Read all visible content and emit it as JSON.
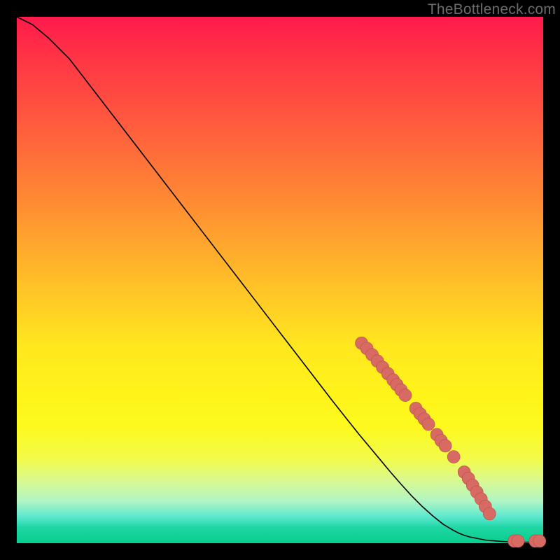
{
  "watermark": "TheBottleneck.com",
  "colors": {
    "frame": "#000000",
    "curve": "#000000",
    "marker_fill": "#d76a63",
    "marker_stroke": "#b94f48"
  },
  "chart_data": {
    "type": "line",
    "title": "",
    "xlabel": "",
    "ylabel": "",
    "xlim": [
      0,
      100
    ],
    "ylim": [
      0,
      100
    ],
    "grid": false,
    "legend": false,
    "series": [
      {
        "name": "bottleneck-curve",
        "x": [
          0,
          3,
          6,
          10,
          15,
          20,
          25,
          30,
          35,
          40,
          45,
          50,
          55,
          60,
          63,
          65,
          67,
          69,
          71,
          73,
          75,
          77,
          79,
          81,
          83,
          84,
          85,
          86,
          87,
          88,
          89,
          90,
          92,
          94,
          95,
          96,
          97,
          98,
          99,
          100
        ],
        "y": [
          100,
          98.5,
          96,
          92,
          85.5,
          79,
          72.5,
          66,
          59.5,
          53,
          46.5,
          40,
          33.5,
          27,
          23.2,
          20.7,
          18.3,
          15.9,
          13.5,
          11.2,
          9,
          7,
          5.2,
          3.6,
          2.4,
          1.9,
          1.5,
          1.2,
          1.0,
          0.8,
          0.6,
          0.5,
          0.35,
          0.25,
          0.22,
          0.2,
          0.2,
          0.2,
          0.2,
          0.2
        ]
      }
    ],
    "markers": [
      {
        "x": 65.5,
        "y": 38,
        "r": 1.2
      },
      {
        "x": 66.5,
        "y": 37,
        "r": 1.2
      },
      {
        "x": 67.5,
        "y": 35.8,
        "r": 1.2
      },
      {
        "x": 68.5,
        "y": 34.6,
        "r": 1.2
      },
      {
        "x": 69.5,
        "y": 33.4,
        "r": 1.2
      },
      {
        "x": 70.5,
        "y": 32.2,
        "r": 1.2
      },
      {
        "x": 71.5,
        "y": 31.0,
        "r": 1.2
      },
      {
        "x": 72.2,
        "y": 30.1,
        "r": 1.2
      },
      {
        "x": 73.0,
        "y": 29.1,
        "r": 1.2
      },
      {
        "x": 73.8,
        "y": 28.1,
        "r": 1.2
      },
      {
        "x": 75.8,
        "y": 25.6,
        "r": 1.2
      },
      {
        "x": 76.6,
        "y": 24.6,
        "r": 1.2
      },
      {
        "x": 77.4,
        "y": 23.6,
        "r": 1.2
      },
      {
        "x": 78.2,
        "y": 22.6,
        "r": 1.2
      },
      {
        "x": 79.8,
        "y": 20.6,
        "r": 1.2
      },
      {
        "x": 80.6,
        "y": 19.5,
        "r": 1.2
      },
      {
        "x": 81.4,
        "y": 18.5,
        "r": 1.2
      },
      {
        "x": 83.0,
        "y": 16.4,
        "r": 1.2
      },
      {
        "x": 85.0,
        "y": 13.5,
        "r": 1.2
      },
      {
        "x": 85.8,
        "y": 12.3,
        "r": 1.2
      },
      {
        "x": 86.6,
        "y": 11.0,
        "r": 1.2
      },
      {
        "x": 87.4,
        "y": 9.7,
        "r": 1.2
      },
      {
        "x": 88.2,
        "y": 8.4,
        "r": 1.2
      },
      {
        "x": 89.0,
        "y": 7.0,
        "r": 1.2
      },
      {
        "x": 89.8,
        "y": 5.6,
        "r": 1.2
      },
      {
        "x": 94.5,
        "y": 0.4,
        "r": 1.2
      },
      {
        "x": 95.2,
        "y": 0.4,
        "r": 1.2
      },
      {
        "x": 98.5,
        "y": 0.4,
        "r": 1.2
      },
      {
        "x": 99.3,
        "y": 0.4,
        "r": 1.2
      }
    ]
  }
}
